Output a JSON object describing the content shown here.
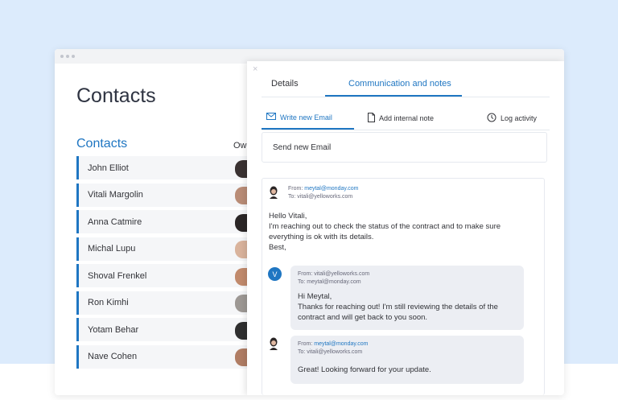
{
  "window": {
    "title_dots": 3
  },
  "left": {
    "page_title": "Contacts",
    "section_title": "Contacts",
    "owner_header": "Own",
    "contacts": [
      "John Elliot",
      "Vitali Margolin",
      "Anna Catmire",
      "Michal Lupu",
      "Shoval Frenkel",
      "Ron Kimhi",
      "Yotam Behar",
      "Nave Cohen"
    ]
  },
  "panel": {
    "close_label": "×",
    "tabs": [
      {
        "label": "Details"
      },
      {
        "label": "Communication and notes"
      }
    ],
    "subtabs": [
      {
        "label": "Write new Email",
        "icon": "mail-icon"
      },
      {
        "label": "Add internal note",
        "icon": "note-icon"
      },
      {
        "label": "Log activity",
        "icon": "clock-icon"
      }
    ],
    "email_placeholder": "Send new Email",
    "messages": [
      {
        "from_label": "From:",
        "from": "meytal@monday.com",
        "to_label": "To:",
        "to": "vitali@yelloworks.com",
        "lines": [
          "Hello Vitali,",
          "I'm reaching out to check the status of the contract and  to make sure",
          "everything is ok with its details.",
          "Best,"
        ]
      },
      {
        "avatar_letter": "V",
        "from_label": "From:",
        "from": "vitali@yelloworks.com",
        "to_label": "To:",
        "to": "meytal@monday.com",
        "lines": [
          "Hi Meytal,",
          "Thanks for reaching out! I'm still reviewing the details of the",
          "contract and will get back to you soon."
        ]
      },
      {
        "from_label": "From:",
        "from": "meytal@monday.com",
        "to_label": "To:",
        "to": "vitali@yelloworks.com",
        "lines": [
          "Great! Looking forward for your update."
        ]
      }
    ]
  },
  "colors": {
    "accent": "#1f76c2",
    "background": "#dcebfc",
    "bubble": "#eceef3"
  }
}
